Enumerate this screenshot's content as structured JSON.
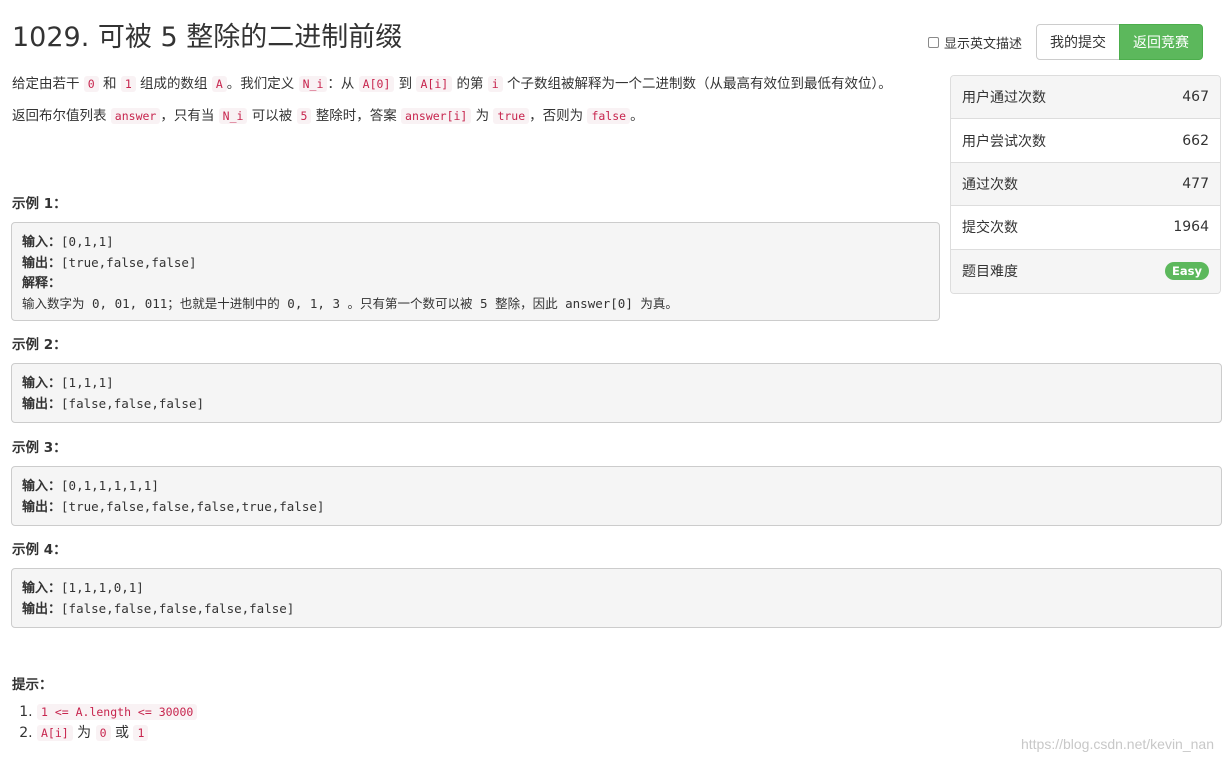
{
  "problem": {
    "title": "1029. 可被 5 整除的二进制前缀",
    "desc1": {
      "t1": "给定由若干 ",
      "c1": "0",
      "t2": " 和 ",
      "c2": "1",
      "t3": " 组成的数组 ",
      "c3": "A",
      "t4": "。我们定义 ",
      "c4": "N_i",
      "t5": "：从 ",
      "c5": "A[0]",
      "t6": " 到 ",
      "c6": "A[i]",
      "t7": " 的第 ",
      "c7": "i",
      "t8": " 个子数组被解释为一个二进制数（从最高有效位到最低有效位）。"
    },
    "desc2": {
      "t1": "返回布尔值列表 ",
      "c1": "answer",
      "t2": "，只有当 ",
      "c2": "N_i",
      "t3": " 可以被 ",
      "c3": "5",
      "t4": " 整除时，答案 ",
      "c4": "answer[i]",
      "t5": " 为 ",
      "c5": "true",
      "t6": "，否则为 ",
      "c6": "false",
      "t7": "。"
    }
  },
  "toolbar": {
    "english_toggle_label": "显示英文描述",
    "my_submissions": "我的提交",
    "back_to_contest": "返回竞赛"
  },
  "stats": {
    "users_accepted_label": "用户通过次数",
    "users_accepted": "467",
    "users_tried_label": "用户尝试次数",
    "users_tried": "662",
    "accepted_label": "通过次数",
    "accepted": "477",
    "submissions_label": "提交次数",
    "submissions": "1964",
    "difficulty_label": "题目难度",
    "difficulty": "Easy"
  },
  "labels": {
    "input": "输入：",
    "output": "输出：",
    "explanation": "解释："
  },
  "examples": [
    {
      "title": "示例 1：",
      "input": "[0,1,1]",
      "output": "[true,false,false]",
      "explanation": "输入数字为 0, 01, 011；也就是十进制中的 0, 1, 3 。只有第一个数可以被 5 整除，因此 answer[0] 为真。"
    },
    {
      "title": "示例 2：",
      "input": "[1,1,1]",
      "output": "[false,false,false]"
    },
    {
      "title": "示例 3：",
      "input": "[0,1,1,1,1,1]",
      "output": "[true,false,false,false,true,false]"
    },
    {
      "title": "示例 4：",
      "input": "[1,1,1,0,1]",
      "output": "[false,false,false,false,false]"
    }
  ],
  "hints": {
    "title": "提示：",
    "h1_code": "1 <= A.length <= 30000",
    "h2": {
      "c1": "A[i]",
      "t1": " 为 ",
      "c2": "0",
      "t2": " 或 ",
      "c3": "1"
    }
  },
  "watermark": "https://blog.csdn.net/kevin_nan",
  "colors": {
    "success": "#5cb85c",
    "code_text": "#c7254e",
    "code_bg": "#f9f2f4",
    "pre_bg": "#f5f5f5"
  }
}
